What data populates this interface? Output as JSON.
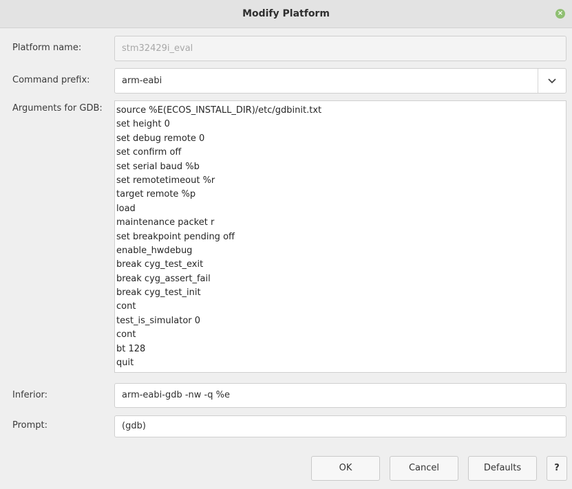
{
  "window": {
    "title": "Modify Platform"
  },
  "form": {
    "platform_name": {
      "label": "Platform name:",
      "value": "stm32429i_eval"
    },
    "command_prefix": {
      "label": "Command prefix:",
      "value": "arm-eabi"
    },
    "gdb_args": {
      "label": "Arguments for GDB:",
      "lines": [
        "source %E(ECOS_INSTALL_DIR)/etc/gdbinit.txt",
        "set height 0",
        "set debug remote 0",
        "set confirm off",
        "set serial baud %b",
        "set remotetimeout %r",
        "target remote %p",
        "load",
        "maintenance packet r",
        "set breakpoint pending off",
        "enable_hwdebug",
        "break cyg_test_exit",
        "break cyg_assert_fail",
        "break cyg_test_init",
        "cont",
        "test_is_simulator 0",
        "cont",
        "bt 128",
        "quit"
      ]
    },
    "inferior": {
      "label": "Inferior:",
      "value": "arm-eabi-gdb -nw -q %e"
    },
    "prompt": {
      "label": "Prompt:",
      "value": "(gdb)"
    }
  },
  "buttons": {
    "ok": "OK",
    "cancel": "Cancel",
    "defaults": "Defaults",
    "help": "?"
  },
  "icons": {
    "close": "close-icon",
    "dropdown": "chevron-down-icon"
  }
}
